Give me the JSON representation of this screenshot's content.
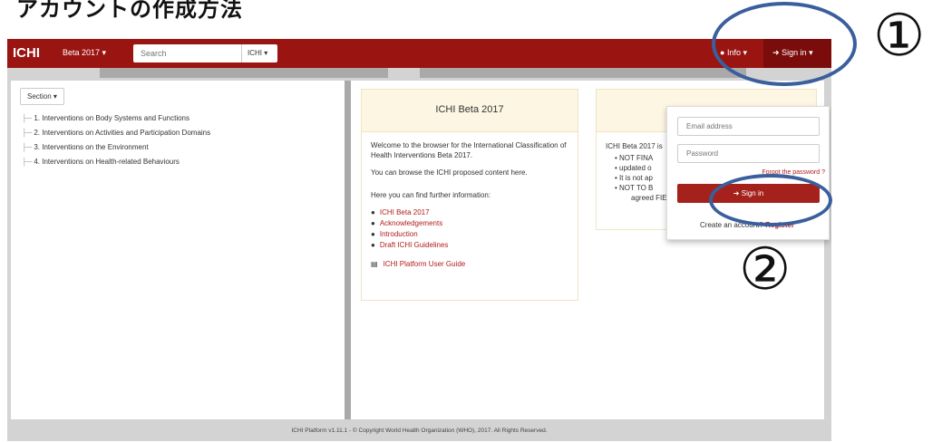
{
  "heading": "アカウントの作成方法",
  "navbar": {
    "brand": "ICHI",
    "version": "Beta 2017 ▾",
    "search_placeholder": "Search",
    "search_scope": "ICHI ▾",
    "info": "Info ▾",
    "signin": "Sign in ▾"
  },
  "section_button": "Section ▾",
  "tree": [
    "1. Interventions on Body Systems and Functions",
    "2. Interventions on Activities and Participation Domains",
    "3. Interventions on the Environment",
    "4. Interventions on Health-related Behaviours"
  ],
  "panel1": {
    "title": "ICHI Beta 2017",
    "welcome": "Welcome to the browser for the International Classification of Health Interventions Beta 2017.",
    "browse": "You can browse the ICHI proposed content here.",
    "further": "Here you can find further information:",
    "links": [
      "ICHI Beta 2017",
      "Acknowledgements",
      "Introduction",
      "Draft ICHI Guidelines"
    ],
    "guide": "ICHI Platform User Guide"
  },
  "panel2": {
    "intro": "ICHI Beta 2017 is",
    "bullets": [
      "NOT FINA",
      "updated o",
      "It is not ap",
      "NOT TO B"
    ],
    "trail": "agreed FIELD TRIALS."
  },
  "signin_dropdown": {
    "email_placeholder": "Email address",
    "password_placeholder": "Password",
    "forgot": "Forgot the password ?",
    "button": "Sign in",
    "create": "Create an account?",
    "register": "Register"
  },
  "footer": "ICHI Platform v1.11.1 - © Copyright World Health Organization (WHO), 2017. All Rights Reserved.",
  "annotations": [
    "①",
    "②"
  ],
  "colors": {
    "navbar": "#9a1412",
    "accent": "#b31c1c",
    "panel_header": "#fcf6e2",
    "oval": "#3a5f9c"
  }
}
